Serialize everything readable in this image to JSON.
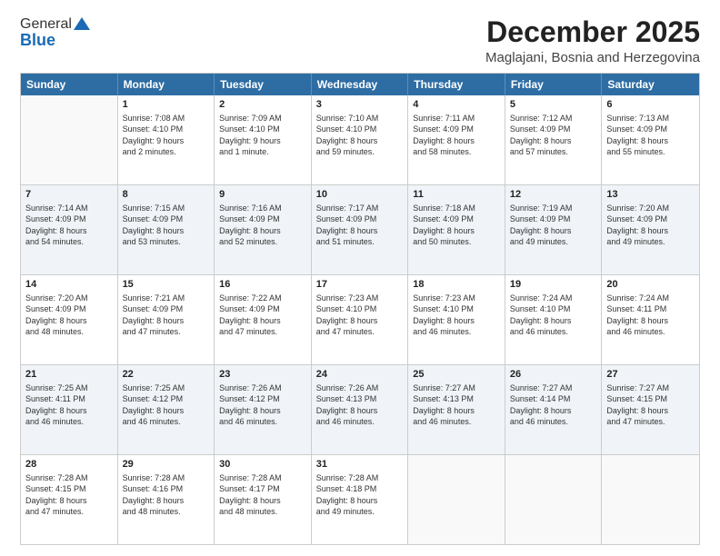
{
  "header": {
    "logo_line1": "General",
    "logo_line2": "Blue",
    "main_title": "December 2025",
    "subtitle": "Maglajani, Bosnia and Herzegovina"
  },
  "days": [
    "Sunday",
    "Monday",
    "Tuesday",
    "Wednesday",
    "Thursday",
    "Friday",
    "Saturday"
  ],
  "rows": [
    [
      {
        "num": "",
        "info": ""
      },
      {
        "num": "1",
        "info": "Sunrise: 7:08 AM\nSunset: 4:10 PM\nDaylight: 9 hours\nand 2 minutes."
      },
      {
        "num": "2",
        "info": "Sunrise: 7:09 AM\nSunset: 4:10 PM\nDaylight: 9 hours\nand 1 minute."
      },
      {
        "num": "3",
        "info": "Sunrise: 7:10 AM\nSunset: 4:10 PM\nDaylight: 8 hours\nand 59 minutes."
      },
      {
        "num": "4",
        "info": "Sunrise: 7:11 AM\nSunset: 4:09 PM\nDaylight: 8 hours\nand 58 minutes."
      },
      {
        "num": "5",
        "info": "Sunrise: 7:12 AM\nSunset: 4:09 PM\nDaylight: 8 hours\nand 57 minutes."
      },
      {
        "num": "6",
        "info": "Sunrise: 7:13 AM\nSunset: 4:09 PM\nDaylight: 8 hours\nand 55 minutes."
      }
    ],
    [
      {
        "num": "7",
        "info": "Sunrise: 7:14 AM\nSunset: 4:09 PM\nDaylight: 8 hours\nand 54 minutes."
      },
      {
        "num": "8",
        "info": "Sunrise: 7:15 AM\nSunset: 4:09 PM\nDaylight: 8 hours\nand 53 minutes."
      },
      {
        "num": "9",
        "info": "Sunrise: 7:16 AM\nSunset: 4:09 PM\nDaylight: 8 hours\nand 52 minutes."
      },
      {
        "num": "10",
        "info": "Sunrise: 7:17 AM\nSunset: 4:09 PM\nDaylight: 8 hours\nand 51 minutes."
      },
      {
        "num": "11",
        "info": "Sunrise: 7:18 AM\nSunset: 4:09 PM\nDaylight: 8 hours\nand 50 minutes."
      },
      {
        "num": "12",
        "info": "Sunrise: 7:19 AM\nSunset: 4:09 PM\nDaylight: 8 hours\nand 49 minutes."
      },
      {
        "num": "13",
        "info": "Sunrise: 7:20 AM\nSunset: 4:09 PM\nDaylight: 8 hours\nand 49 minutes."
      }
    ],
    [
      {
        "num": "14",
        "info": "Sunrise: 7:20 AM\nSunset: 4:09 PM\nDaylight: 8 hours\nand 48 minutes."
      },
      {
        "num": "15",
        "info": "Sunrise: 7:21 AM\nSunset: 4:09 PM\nDaylight: 8 hours\nand 47 minutes."
      },
      {
        "num": "16",
        "info": "Sunrise: 7:22 AM\nSunset: 4:09 PM\nDaylight: 8 hours\nand 47 minutes."
      },
      {
        "num": "17",
        "info": "Sunrise: 7:23 AM\nSunset: 4:10 PM\nDaylight: 8 hours\nand 47 minutes."
      },
      {
        "num": "18",
        "info": "Sunrise: 7:23 AM\nSunset: 4:10 PM\nDaylight: 8 hours\nand 46 minutes."
      },
      {
        "num": "19",
        "info": "Sunrise: 7:24 AM\nSunset: 4:10 PM\nDaylight: 8 hours\nand 46 minutes."
      },
      {
        "num": "20",
        "info": "Sunrise: 7:24 AM\nSunset: 4:11 PM\nDaylight: 8 hours\nand 46 minutes."
      }
    ],
    [
      {
        "num": "21",
        "info": "Sunrise: 7:25 AM\nSunset: 4:11 PM\nDaylight: 8 hours\nand 46 minutes."
      },
      {
        "num": "22",
        "info": "Sunrise: 7:25 AM\nSunset: 4:12 PM\nDaylight: 8 hours\nand 46 minutes."
      },
      {
        "num": "23",
        "info": "Sunrise: 7:26 AM\nSunset: 4:12 PM\nDaylight: 8 hours\nand 46 minutes."
      },
      {
        "num": "24",
        "info": "Sunrise: 7:26 AM\nSunset: 4:13 PM\nDaylight: 8 hours\nand 46 minutes."
      },
      {
        "num": "25",
        "info": "Sunrise: 7:27 AM\nSunset: 4:13 PM\nDaylight: 8 hours\nand 46 minutes."
      },
      {
        "num": "26",
        "info": "Sunrise: 7:27 AM\nSunset: 4:14 PM\nDaylight: 8 hours\nand 46 minutes."
      },
      {
        "num": "27",
        "info": "Sunrise: 7:27 AM\nSunset: 4:15 PM\nDaylight: 8 hours\nand 47 minutes."
      }
    ],
    [
      {
        "num": "28",
        "info": "Sunrise: 7:28 AM\nSunset: 4:15 PM\nDaylight: 8 hours\nand 47 minutes."
      },
      {
        "num": "29",
        "info": "Sunrise: 7:28 AM\nSunset: 4:16 PM\nDaylight: 8 hours\nand 48 minutes."
      },
      {
        "num": "30",
        "info": "Sunrise: 7:28 AM\nSunset: 4:17 PM\nDaylight: 8 hours\nand 48 minutes."
      },
      {
        "num": "31",
        "info": "Sunrise: 7:28 AM\nSunset: 4:18 PM\nDaylight: 8 hours\nand 49 minutes."
      },
      {
        "num": "",
        "info": ""
      },
      {
        "num": "",
        "info": ""
      },
      {
        "num": "",
        "info": ""
      }
    ]
  ]
}
